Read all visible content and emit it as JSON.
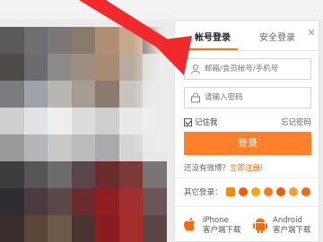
{
  "login": {
    "tabs": [
      {
        "label": "帐号登录",
        "active": true
      },
      {
        "label": "安全登录",
        "active": false
      }
    ],
    "close_icon": "close-icon",
    "account_placeholder": "邮箱/会员帐号/手机号",
    "password_placeholder": "请输入密码",
    "remember_label": "记住我",
    "remember_checked": true,
    "forgot_label": "忘记密码",
    "login_button": "登录",
    "no_account_text": "还没有微博？",
    "register_link": "立即注册!",
    "other_login_label": "其它登录：",
    "social_icons": [
      "weibo-icon",
      "taobao-icon",
      "qq-icon",
      "alipay-icon",
      "wechat-icon",
      "renren-icon",
      "more-icon"
    ],
    "downloads": [
      {
        "title": "iPhone",
        "subtitle": "客户端下载",
        "icon": "apple-icon"
      },
      {
        "title": "Android",
        "subtitle": "客户端下载",
        "icon": "android-icon"
      }
    ]
  },
  "colors": {
    "accent": "#ff7f2a",
    "arrow": "#f02a2a",
    "register": "#ff6a00"
  }
}
